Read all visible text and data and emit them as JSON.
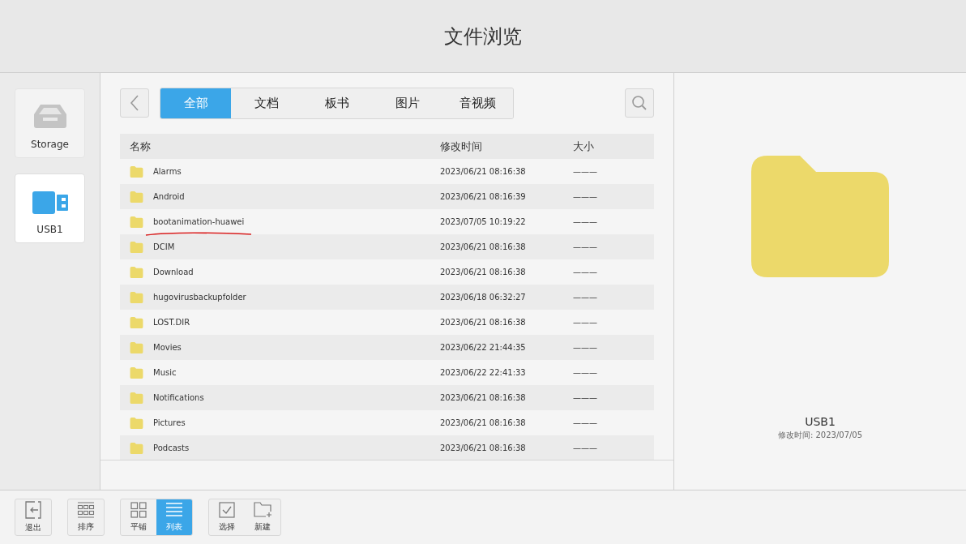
{
  "window": {
    "title": "文件浏览"
  },
  "sidebar": {
    "devices": [
      {
        "kind": "storage",
        "label": "Storage",
        "selected": false
      },
      {
        "kind": "usb",
        "label": "USB1",
        "selected": true
      }
    ]
  },
  "tabs": [
    {
      "label": "全部",
      "selected": true
    },
    {
      "label": "文档",
      "selected": false
    },
    {
      "label": "板书",
      "selected": false
    },
    {
      "label": "图片",
      "selected": false
    },
    {
      "label": "音视频",
      "selected": false
    }
  ],
  "table": {
    "columns": [
      "名称",
      "修改时间",
      "大小"
    ],
    "rows": [
      {
        "name": "Alarms",
        "modified": "2023/06/21 08:16:38",
        "size": "———",
        "annotated": false
      },
      {
        "name": "Android",
        "modified": "2023/06/21 08:16:39",
        "size": "———",
        "annotated": false
      },
      {
        "name": "bootanimation-huawei",
        "modified": "2023/07/05 10:19:22",
        "size": "———",
        "annotated": true
      },
      {
        "name": "DCIM",
        "modified": "2023/06/21 08:16:38",
        "size": "———",
        "annotated": false
      },
      {
        "name": "Download",
        "modified": "2023/06/21 08:16:38",
        "size": "———",
        "annotated": false
      },
      {
        "name": "hugovirusbackupfolder",
        "modified": "2023/06/18 06:32:27",
        "size": "———",
        "annotated": false
      },
      {
        "name": "LOST.DIR",
        "modified": "2023/06/21 08:16:38",
        "size": "———",
        "annotated": false
      },
      {
        "name": "Movies",
        "modified": "2023/06/22 21:44:35",
        "size": "———",
        "annotated": false
      },
      {
        "name": "Music",
        "modified": "2023/06/22 22:41:33",
        "size": "———",
        "annotated": false
      },
      {
        "name": "Notifications",
        "modified": "2023/06/21 08:16:38",
        "size": "———",
        "annotated": false
      },
      {
        "name": "Pictures",
        "modified": "2023/06/21 08:16:38",
        "size": "———",
        "annotated": false
      },
      {
        "name": "Podcasts",
        "modified": "2023/06/21 08:16:38",
        "size": "———",
        "annotated": false
      }
    ]
  },
  "preview": {
    "name": "USB1",
    "modified": "修改时间: 2023/07/05"
  },
  "toolbar": {
    "groups": [
      [
        {
          "kind": "exit",
          "label": "退出",
          "selected": false
        }
      ],
      [
        {
          "kind": "sort",
          "label": "排序",
          "selected": false
        }
      ],
      [
        {
          "kind": "grid",
          "label": "平铺",
          "selected": false
        },
        {
          "kind": "list",
          "label": "列表",
          "selected": true
        }
      ],
      [
        {
          "kind": "select",
          "label": "选择",
          "selected": false
        },
        {
          "kind": "new-folder",
          "label": "新建",
          "selected": false
        }
      ]
    ]
  }
}
